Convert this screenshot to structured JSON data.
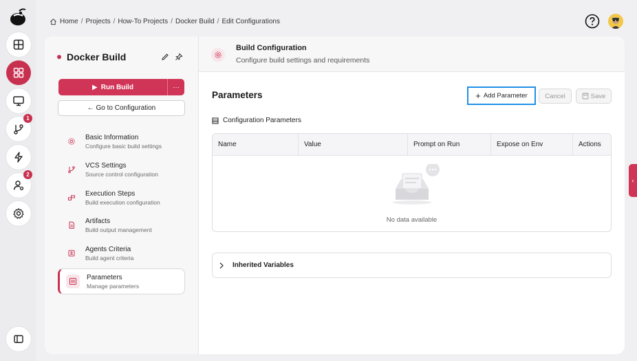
{
  "breadcrumb": {
    "items": [
      "Home",
      "Projects",
      "How-To Projects",
      "Docker Build",
      "Edit Configurations"
    ],
    "separator": "/"
  },
  "rail": {
    "items": [
      {
        "icon": "dashboard-icon"
      },
      {
        "icon": "grid-icon",
        "active": true
      },
      {
        "icon": "monitor-icon"
      },
      {
        "icon": "branch-icon",
        "badge": "1"
      },
      {
        "icon": "bolt-icon"
      },
      {
        "icon": "user-settings-icon",
        "badge": "2"
      },
      {
        "icon": "gear-icon"
      },
      {
        "icon": "sidebar-toggle-icon"
      }
    ]
  },
  "project": {
    "title": "Docker Build",
    "run_label": "Run Build",
    "more_label": "···",
    "goto_label": "← Go to Configuration"
  },
  "nav": [
    {
      "label": "Basic Information",
      "sub": "Configure basic build settings",
      "icon": "gear-icon"
    },
    {
      "label": "VCS Settings",
      "sub": "Source control configuration",
      "icon": "branch-icon"
    },
    {
      "label": "Execution Steps",
      "sub": "Build execution configuration",
      "icon": "steps-icon"
    },
    {
      "label": "Artifacts",
      "sub": "Build output management",
      "icon": "file-icon"
    },
    {
      "label": "Agents Criteria",
      "sub": "Build agent criteria",
      "icon": "agent-icon"
    },
    {
      "label": "Parameters",
      "sub": "Manage parameters",
      "icon": "sliders-icon",
      "active": true
    }
  ],
  "config": {
    "title": "Build Configuration",
    "subtitle": "Configure build settings and requirements"
  },
  "parameters": {
    "title": "Parameters",
    "add_label": "Add Parameter",
    "cancel_label": "Cancel",
    "save_label": "Save",
    "section_label": "Configuration Parameters",
    "columns": [
      "Name",
      "Value",
      "Prompt on Run",
      "Expose on Env",
      "Actions"
    ],
    "empty_text": "No data available",
    "inherited_label": "Inherited Variables"
  },
  "colors": {
    "accent": "#c8304f",
    "focus": "#1f8fe6"
  }
}
